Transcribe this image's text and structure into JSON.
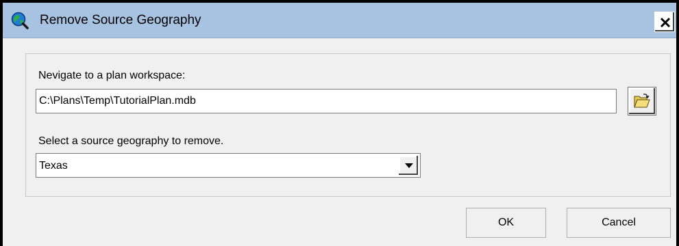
{
  "window": {
    "title": "Remove Source Geography",
    "app_icon": "globe-magnifier-icon",
    "close_icon": "close-icon"
  },
  "workspace": {
    "label": "Nevigate to a plan workspace:",
    "value": "C:\\Plans\\Temp\\TutorialPlan.mdb",
    "browse_icon": "open-folder-icon"
  },
  "source": {
    "label": "Select a source geography to remove.",
    "selected": "Texas",
    "arrow_icon": "chevron-down-icon"
  },
  "buttons": {
    "ok": "OK",
    "cancel": "Cancel"
  },
  "colors": {
    "titlebar": "#a8c2e1",
    "dialog_bg": "#f0f0f0"
  }
}
